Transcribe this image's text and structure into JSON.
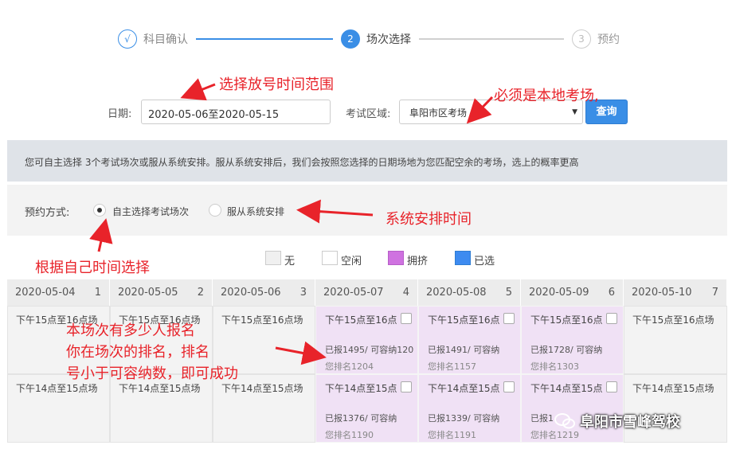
{
  "stepper": {
    "steps": [
      {
        "symbol": "√",
        "label": "科目确认"
      },
      {
        "symbol": "2",
        "label": "场次选择"
      },
      {
        "symbol": "3",
        "label": "预约"
      }
    ]
  },
  "filter": {
    "date_label": "日期:",
    "date_value": "2020-05-06至2020-05-15",
    "region_label": "考试区域:",
    "region_value": "阜阳市区考场",
    "query_button": "查询"
  },
  "notice": "您可自主选择 3个考试场次或服从系统安排。服从系统安排后，我们会按照您选择的日期场地为您匹配空余的考场，选上的概率更高",
  "mode": {
    "label": "预约方式:",
    "option_self": "自主选择考试场次",
    "option_system": "服从系统安排"
  },
  "legend": {
    "none": "无",
    "free": "空闲",
    "crowded": "拥挤",
    "selected": "已选"
  },
  "colors": {
    "accent": "#3a8ee6",
    "crowded": "#cf72e0",
    "selected": "#3d8bf0",
    "annotation": "#e8232a"
  },
  "table": {
    "days": [
      {
        "date": "2020-05-04",
        "num": "1"
      },
      {
        "date": "2020-05-05",
        "num": "2"
      },
      {
        "date": "2020-05-06",
        "num": "3"
      },
      {
        "date": "2020-05-07",
        "num": "4"
      },
      {
        "date": "2020-05-08",
        "num": "5"
      },
      {
        "date": "2020-05-09",
        "num": "6"
      },
      {
        "date": "2020-05-10",
        "num": "7"
      }
    ],
    "row1": {
      "plain_slot": "下午15点至16点场",
      "crowd_slot": "下午15点至16点",
      "cells": [
        {
          "reg": "已报1495/ 可容纳120",
          "rank": "您排名1204"
        },
        {
          "reg": "已报1491/ 可容纳",
          "rank": "您排名1157"
        },
        {
          "reg": "已报1728/ 可容纳",
          "rank": "您排名1303"
        }
      ]
    },
    "row2": {
      "plain_slot": "下午14点至15点场",
      "crowd_slot": "下午14点至15点",
      "cells": [
        {
          "reg": "已报1376/ 可容纳",
          "rank": "您排名1190"
        },
        {
          "reg": "已报1339/ 可容纳",
          "rank": "您排名1191"
        },
        {
          "reg": "已报1",
          "rank": "您排名1219"
        }
      ]
    }
  },
  "annotations": {
    "date_range": "选择放号时间范围",
    "local_venue": "必须是本地考场,",
    "system_time": "系统安排时间",
    "own_time": "根据自己时间选择",
    "rank_line1": "本场次有多少人报名",
    "rank_line2": "你在场次的排名，排名",
    "rank_line3": "号小于可容纳数，即可成功"
  },
  "watermark": "阜阳市雪峰驾校"
}
